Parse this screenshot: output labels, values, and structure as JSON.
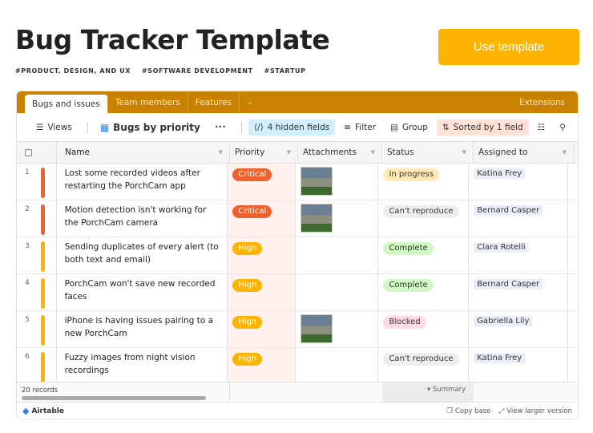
{
  "title": "Bug Tracker Template",
  "tags": [
    "#PRODUCT, DESIGN, AND UX",
    "#SOFTWARE DEVELOPMENT",
    "#STARTUP"
  ],
  "use_template": "Use template",
  "tabs": [
    "Bugs and issues",
    "Team members",
    "Features"
  ],
  "extensions": "Extensions",
  "toolbar": {
    "views": "Views",
    "view_name": "Bugs by priority",
    "more": "•••",
    "hidden": "4 hidden fields",
    "filter": "Filter",
    "group": "Group",
    "sorted": "Sorted by 1 field"
  },
  "columns": [
    "Name",
    "Priority",
    "Attachments",
    "Status",
    "Assigned to"
  ],
  "rows": [
    {
      "num": "1",
      "name": "Lost some recorded videos after restarting the PorchCam app",
      "priority": "Critical",
      "attachment": true,
      "status": "In progress",
      "assigned": "Katina Frey"
    },
    {
      "num": "2",
      "name": "Motion detection isn't working for the PorchCam camera",
      "priority": "Critical",
      "attachment": true,
      "status": "Can't reproduce",
      "assigned": "Bernard Casper"
    },
    {
      "num": "3",
      "name": "Sending duplicates of every alert (to both text and email)",
      "priority": "High",
      "attachment": false,
      "status": "Complete",
      "assigned": "Clara Rotelli"
    },
    {
      "num": "4",
      "name": "PorchCam won't save new recorded faces",
      "priority": "High",
      "attachment": false,
      "status": "Complete",
      "assigned": "Bernard Casper"
    },
    {
      "num": "5",
      "name": "iPhone is having issues pairing to a new PorchCam",
      "priority": "High",
      "attachment": true,
      "status": "Blocked",
      "assigned": "Gabriella Lily"
    },
    {
      "num": "6",
      "name": "Fuzzy images from night vision recordings",
      "priority": "High",
      "attachment": false,
      "status": "Can't reproduce",
      "assigned": "Katina Frey"
    }
  ],
  "footer": {
    "records": "20 records",
    "summary": "▾ Summary"
  },
  "bottom": {
    "brand": "Airtable",
    "copy": "Copy base",
    "larger": "View larger version"
  },
  "colors": {
    "Critical": "#f0622d",
    "High": "#fcb400",
    "In progress": "#ffeab6",
    "Can't reproduce": "#eeeeee",
    "Complete": "#d1f7c4",
    "Blocked": "#ffdce5"
  }
}
